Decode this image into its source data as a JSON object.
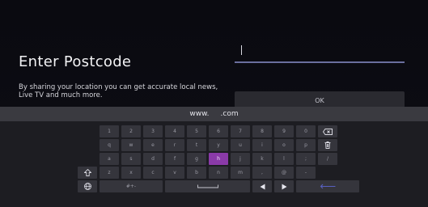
{
  "title": "Enter Postcode",
  "description": "By sharing your location you can get accurate local news, Live TV and much more.",
  "input": {
    "value": ""
  },
  "ok_label": "OK",
  "url_bar": {
    "prefix": "www.",
    "suffix": ".com"
  },
  "keyboard": {
    "rows": [
      [
        "1",
        "2",
        "3",
        "4",
        "5",
        "6",
        "7",
        "8",
        "9",
        "0"
      ],
      [
        "q",
        "w",
        "e",
        "r",
        "t",
        "y",
        "u",
        "i",
        "o",
        "p"
      ],
      [
        "a",
        "s",
        "d",
        "f",
        "g",
        "h",
        "j",
        "k",
        "l",
        ";",
        "/"
      ],
      [
        "z",
        "x",
        "c",
        "v",
        "b",
        "n",
        "m",
        ",",
        "@",
        "-"
      ]
    ],
    "symbols_label": "#+-",
    "selected_key": "h",
    "icons": {
      "backspace": "backspace-icon",
      "delete": "trash-icon",
      "shift": "shift-icon",
      "language": "globe-icon",
      "space": "space-icon",
      "left": "arrow-left-icon",
      "right": "arrow-right-icon",
      "enter": "enter-icon"
    }
  },
  "colors": {
    "background": "#0a0a10",
    "accent_underline": "#6a6f9e",
    "selected_key": "#8a3aa8",
    "enter_arrow": "#5860c0"
  }
}
